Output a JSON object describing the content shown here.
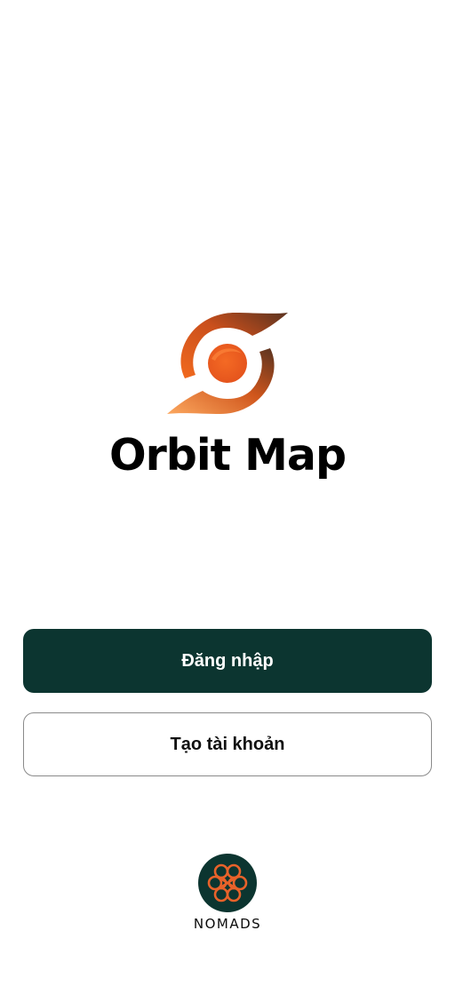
{
  "app": {
    "name": "Orbit Map",
    "logo_icon": "orbit-logo-icon"
  },
  "actions": {
    "login_label": "Đăng nhập",
    "signup_label": "Tạo tài khoản"
  },
  "footer": {
    "brand_name": "NOMADS",
    "brand_icon": "nomads-knot-icon"
  },
  "colors": {
    "primary": "#0c3530",
    "accent": "#f36a21",
    "accent_light": "#fba05a",
    "accent_dark": "#5a3320"
  }
}
